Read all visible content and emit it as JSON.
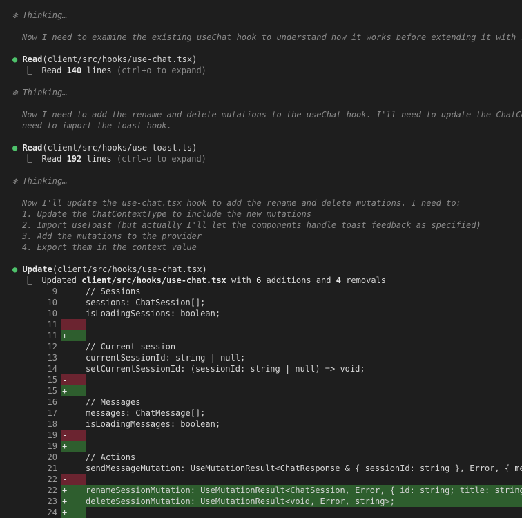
{
  "entries": [
    {
      "type": "thinking",
      "header": "✻ Thinking…",
      "lines": [
        "Now I need to examine the existing useChat hook to understand how it works before extending it with rena"
      ]
    },
    {
      "type": "read",
      "tool": "Read",
      "arg": "(client/src/hooks/use-chat.tsx)",
      "result_prefix": "⎿  Read ",
      "count": "140",
      "result_suffix": " lines",
      "hint": " (ctrl+o to expand)"
    },
    {
      "type": "thinking",
      "header": "✻ Thinking…",
      "lines": [
        "Now I need to add the rename and delete mutations to the useChat hook. I'll need to update the ChatConte",
        "need to import the toast hook."
      ]
    },
    {
      "type": "read",
      "tool": "Read",
      "arg": "(client/src/hooks/use-toast.ts)",
      "result_prefix": "⎿  Read ",
      "count": "192",
      "result_suffix": " lines",
      "hint": " (ctrl+o to expand)"
    },
    {
      "type": "thinking",
      "header": "✻ Thinking…",
      "lines": [
        "Now I'll update the use-chat.tsx hook to add the rename and delete mutations. I need to:",
        "1. Update the ChatContextType to include the new mutations",
        "2. Import useToast (but actually I'll let the components handle toast feedback as specified)",
        "3. Add the mutations to the provider",
        "4. Export them in the context value"
      ]
    }
  ],
  "update": {
    "tool": "Update",
    "arg": "(client/src/hooks/use-chat.tsx)",
    "prefix": "⎿  Updated ",
    "file": "client/src/hooks/use-chat.tsx",
    "mid1": " with ",
    "additions": "6",
    "mid2": " additions and ",
    "removals": "4",
    "suffix": " removals"
  },
  "diff": [
    {
      "n": "9",
      "k": "ctx",
      "t": "// Sessions"
    },
    {
      "n": "10",
      "k": "ctx",
      "t": "sessions: ChatSession[];"
    },
    {
      "n": "10",
      "k": "ctx",
      "t": "isLoadingSessions: boolean;"
    },
    {
      "n": "11",
      "k": "del",
      "t": ""
    },
    {
      "n": "11",
      "k": "add",
      "t": ""
    },
    {
      "n": "12",
      "k": "ctx",
      "t": "// Current session"
    },
    {
      "n": "13",
      "k": "ctx",
      "t": "currentSessionId: string | null;"
    },
    {
      "n": "14",
      "k": "ctx",
      "t": "setCurrentSessionId: (sessionId: string | null) => void;"
    },
    {
      "n": "15",
      "k": "del",
      "t": ""
    },
    {
      "n": "15",
      "k": "add",
      "t": ""
    },
    {
      "n": "16",
      "k": "ctx",
      "t": "// Messages"
    },
    {
      "n": "17",
      "k": "ctx",
      "t": "messages: ChatMessage[];"
    },
    {
      "n": "18",
      "k": "ctx",
      "t": "isLoadingMessages: boolean;"
    },
    {
      "n": "19",
      "k": "del",
      "t": ""
    },
    {
      "n": "19",
      "k": "add",
      "t": ""
    },
    {
      "n": "20",
      "k": "ctx",
      "t": "// Actions"
    },
    {
      "n": "21",
      "k": "ctx",
      "t": "sendMessageMutation: UseMutationResult<ChatResponse & { sessionId: string }, Error, { messa"
    },
    {
      "n": "22",
      "k": "del",
      "t": ""
    },
    {
      "n": "22",
      "k": "add",
      "t": "renameSessionMutation: UseMutationResult<ChatSession, Error, { id: string; title: string }"
    },
    {
      "n": "23",
      "k": "add",
      "t": "deleteSessionMutation: UseMutationResult<void, Error, string>;"
    },
    {
      "n": "24",
      "k": "add",
      "t": ""
    }
  ],
  "diff_signs": {
    "del": "-",
    "add": "+",
    "ctx": ""
  }
}
